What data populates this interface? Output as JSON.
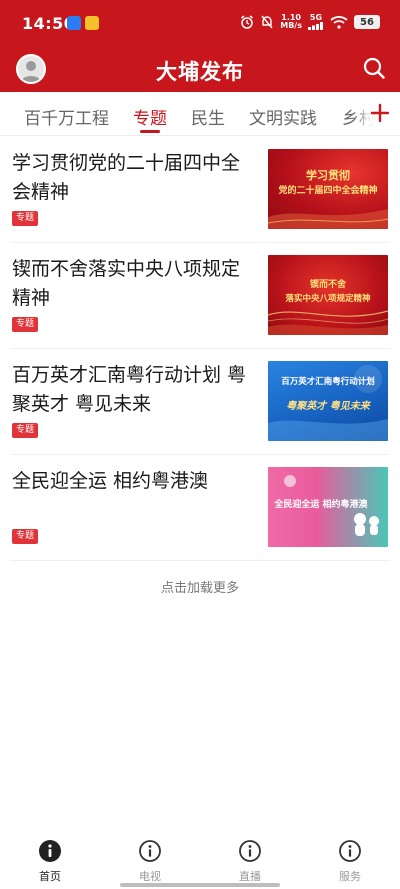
{
  "status_bar": {
    "time": "14:50",
    "net_speed_value": "1.10",
    "net_speed_unit": "MB/s",
    "network": "5G",
    "battery": "56"
  },
  "header": {
    "title": "大埔发布",
    "search_icon": "search-icon",
    "avatar_icon": "avatar-icon"
  },
  "tabs": [
    {
      "label": "百千万工程",
      "active": false
    },
    {
      "label": "专题",
      "active": true
    },
    {
      "label": "民生",
      "active": false
    },
    {
      "label": "文明实践",
      "active": false
    },
    {
      "label": "乡村",
      "active": false
    }
  ],
  "articles": [
    {
      "title": "学习贯彻党的二十届四中全会精神",
      "badge": "专题",
      "thumb_lines": [
        "学习贯彻",
        "党的二十届四中全会精神"
      ]
    },
    {
      "title": "锲而不舍落实中央八项规定精神",
      "badge": "专题",
      "thumb_lines": [
        "锲而不舍",
        "落实中央八项规定精神"
      ]
    },
    {
      "title": "百万英才汇南粤行动计划 粤聚英才 粤见未来",
      "badge": "专题",
      "thumb_lines": [
        "百万英才汇南粤行动计划",
        "粤聚英才 粤见未来"
      ]
    },
    {
      "title": "全民迎全运 相约粤港澳",
      "badge": "专题",
      "thumb_lines": [
        "全民迎全运 相约粤港澳"
      ]
    }
  ],
  "load_more": "点击加载更多",
  "bottom_nav": [
    {
      "label": "首页",
      "icon": "info-icon",
      "active": true
    },
    {
      "label": "电视",
      "icon": "info-icon",
      "active": false
    },
    {
      "label": "直播",
      "icon": "info-icon",
      "active": false
    },
    {
      "label": "服务",
      "icon": "info-icon",
      "active": false
    }
  ],
  "colors": {
    "brand_red": "#c8161d",
    "badge_red": "#e0343a"
  }
}
